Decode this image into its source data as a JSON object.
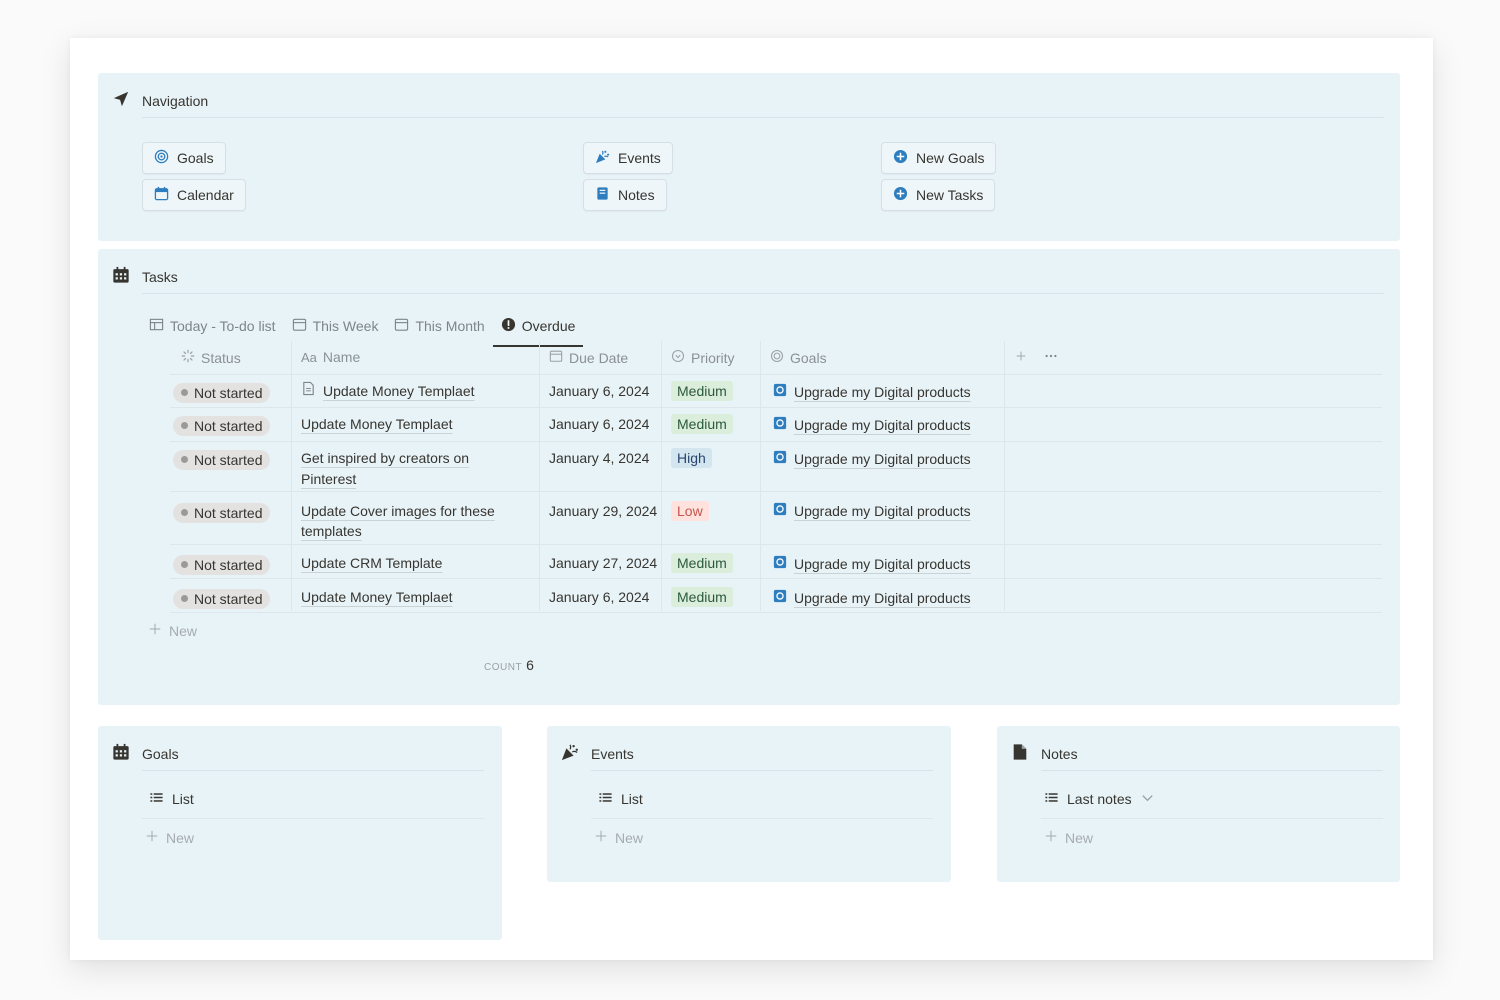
{
  "navigation": {
    "title": "Navigation",
    "buttons": [
      {
        "label": "Goals",
        "icon": "target-icon"
      },
      {
        "label": "Calendar",
        "icon": "calendar-icon"
      },
      {
        "label": "Events",
        "icon": "party-popper-icon"
      },
      {
        "label": "Notes",
        "icon": "notebook-icon"
      },
      {
        "label": "New Goals",
        "icon": "plus-circle-icon"
      },
      {
        "label": "New Tasks",
        "icon": "plus-circle-icon"
      }
    ]
  },
  "tasks": {
    "title": "Tasks",
    "tabs": [
      {
        "label": "Today - To-do list"
      },
      {
        "label": "This Week"
      },
      {
        "label": "This Month"
      },
      {
        "label": "Overdue",
        "active": true
      }
    ],
    "columns": {
      "status": "Status",
      "name": "Name",
      "due": "Due Date",
      "priority": "Priority",
      "goals": "Goals",
      "name_prefix": "Aa"
    },
    "rows": [
      {
        "status": "Not started",
        "name": "Update Money Templaet",
        "due": "January 6, 2024",
        "priority": "Medium",
        "goal": "Upgrade my Digital products"
      },
      {
        "status": "Not started",
        "name": "Update Money Templaet",
        "due": "January 6, 2024",
        "priority": "Medium",
        "goal": "Upgrade my Digital products"
      },
      {
        "status": "Not started",
        "name_line1": "Get inspired by creators on",
        "name_line2": "Pinterest",
        "due": "January 4, 2024",
        "priority": "High",
        "goal": "Upgrade my Digital products"
      },
      {
        "status": "Not started",
        "name_line1": "Update Cover images for these",
        "name_line2": "templates",
        "due": "January 29, 2024",
        "priority": "Low",
        "goal": "Upgrade my Digital products"
      },
      {
        "status": "Not started",
        "name": "Update CRM Template",
        "due": "January 27, 2024",
        "priority": "Medium",
        "goal": "Upgrade my Digital products"
      },
      {
        "status": "Not started",
        "name": "Update Money Templaet",
        "due": "January 6, 2024",
        "priority": "Medium",
        "goal": "Upgrade my Digital products"
      }
    ],
    "new_label": "New",
    "count_label": "COUNT",
    "count_value": "6"
  },
  "goals_panel": {
    "title": "Goals",
    "view": "List",
    "new_label": "New"
  },
  "events_panel": {
    "title": "Events",
    "view": "List",
    "new_label": "New"
  },
  "notes_panel": {
    "title": "Notes",
    "view": "Last notes",
    "new_label": "New"
  },
  "colors": {
    "panel_bg": "#e8f3f8",
    "accent_blue": "#2e7ebf",
    "text": "#37352f"
  }
}
